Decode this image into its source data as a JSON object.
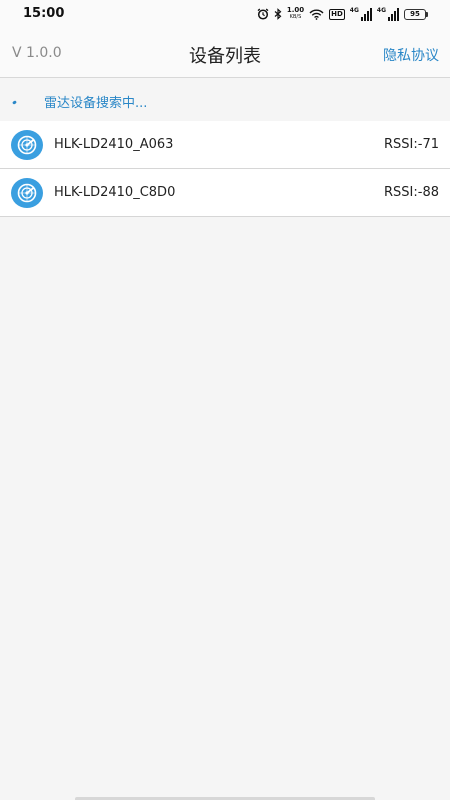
{
  "status_bar": {
    "time": "15:00",
    "net_speed_value": "1.00",
    "net_speed_unit": "KB/S",
    "hd_badge": "HD",
    "sim1_label": "4G",
    "sim2_label": "4G",
    "battery_level": "95"
  },
  "header": {
    "version": "V 1.0.0",
    "title": "设备列表",
    "privacy_link": "隐私协议"
  },
  "scan_status": "雷达设备搜索中...",
  "devices": [
    {
      "name": "HLK-LD2410_A063",
      "rssi": "RSSI:-71"
    },
    {
      "name": "HLK-LD2410_C8D0",
      "rssi": "RSSI:-88"
    }
  ],
  "colors": {
    "accent": "#2a87c7",
    "device_icon_bg": "#3a9fe0",
    "background": "#f5f5f5"
  },
  "icons": {
    "alarm": "alarm-clock-icon",
    "bluetooth": "bluetooth-icon",
    "wifi": "wifi-icon",
    "device": "radar-icon"
  }
}
